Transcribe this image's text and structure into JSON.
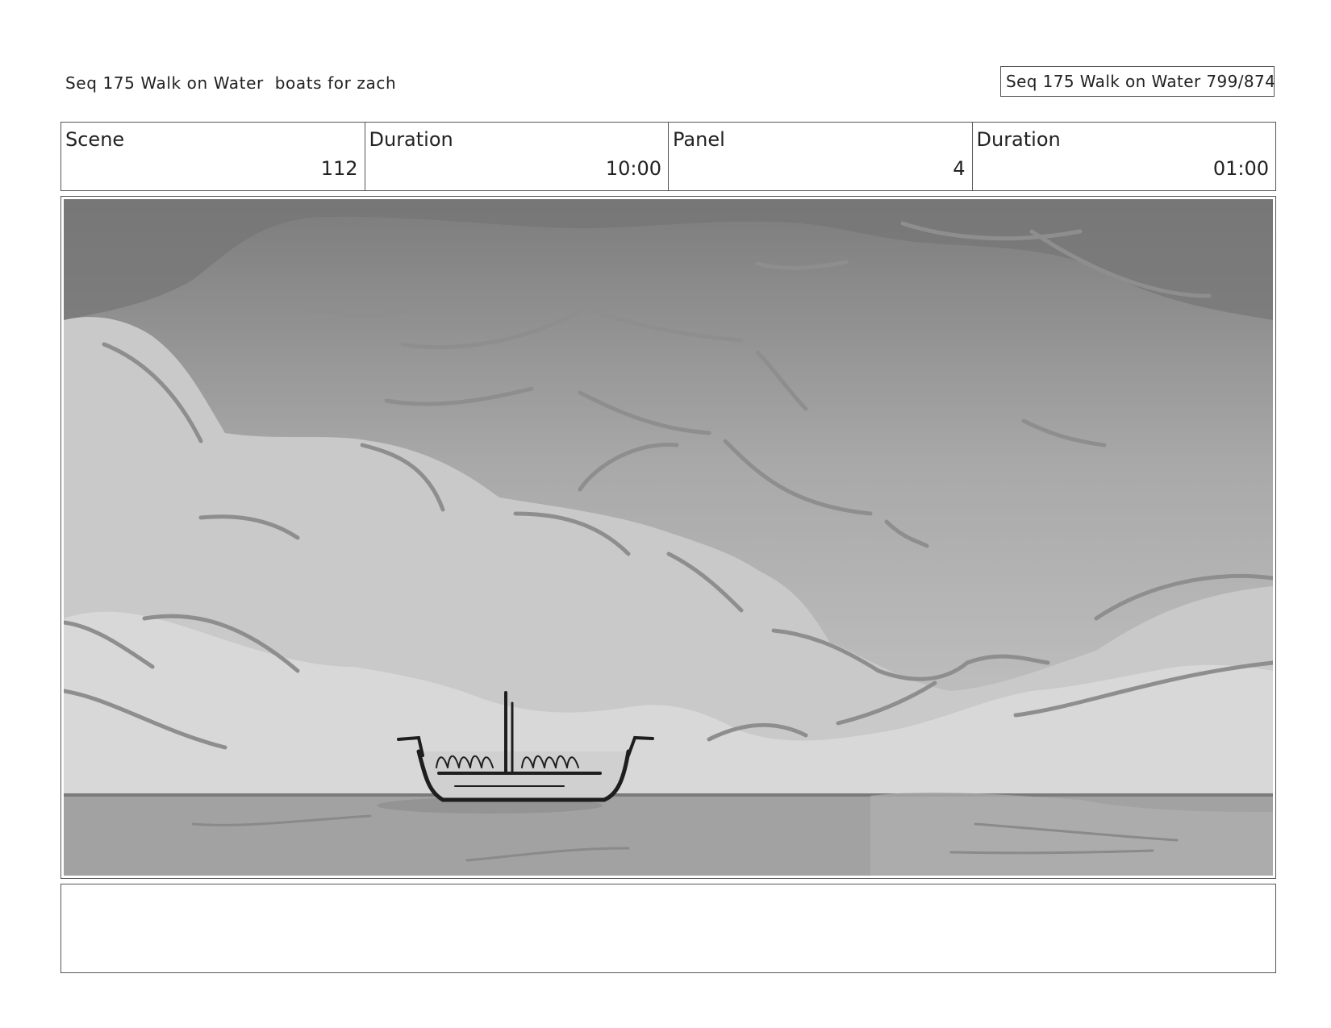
{
  "header": {
    "title": "Seq 175 Walk on Water  boats for zach",
    "page_label": "Seq 175 Walk on Water 799/874"
  },
  "info": {
    "scene_label": "Scene",
    "scene_value": "112",
    "scene_duration_label": "Duration",
    "scene_duration_value": "10:00",
    "panel_label": "Panel",
    "panel_value": "4",
    "panel_duration_label": "Duration",
    "panel_duration_value": "01:00"
  },
  "panel": {
    "image": "storyboard-sketch",
    "description_icon": "boat-on-sea-under-clouds"
  },
  "notes": {
    "text": ""
  },
  "colors": {
    "border": "#555555",
    "text": "#222222",
    "sky_dark": "#7a7a7a",
    "sky_light": "#d4d4d4",
    "sea": "#a3a3a3"
  }
}
